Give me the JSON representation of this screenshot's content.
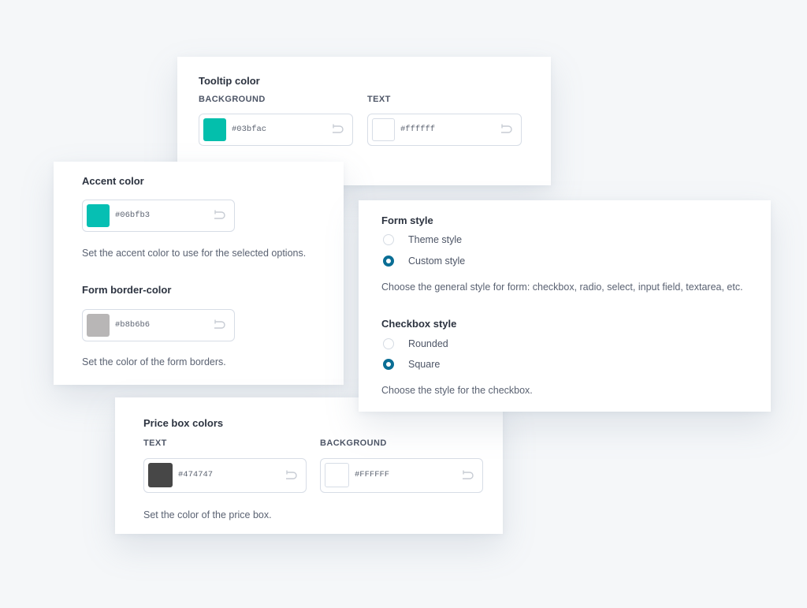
{
  "tooltip_color": {
    "title": "Tooltip color",
    "fields": [
      {
        "label": "BACKGROUND",
        "hex": "#03bfac",
        "swatch": "#03bfac"
      },
      {
        "label": "TEXT",
        "hex": "#ffffff",
        "swatch": "#ffffff"
      }
    ]
  },
  "accent_color": {
    "title": "Accent color",
    "hex": "#06bfb3",
    "swatch": "#06bfb3",
    "description": "Set the accent color to use for the selected options."
  },
  "form_border_color": {
    "title": "Form border-color",
    "hex": "#b8b6b6",
    "swatch": "#b8b6b6",
    "description": "Set the color of the form borders."
  },
  "form_style": {
    "title": "Form style",
    "options": [
      {
        "label": "Theme style",
        "checked": false
      },
      {
        "label": "Custom style",
        "checked": true
      }
    ],
    "description": "Choose the general style for form: checkbox, radio, select, input field, textarea, etc."
  },
  "checkbox_style": {
    "title": "Checkbox style",
    "options": [
      {
        "label": "Rounded",
        "checked": false
      },
      {
        "label": "Square",
        "checked": true
      }
    ],
    "description": "Choose the style for the checkbox."
  },
  "price_box_colors": {
    "title": "Price box colors",
    "fields": [
      {
        "label": "TEXT",
        "hex": "#474747",
        "swatch": "#474747"
      },
      {
        "label": "BACKGROUND",
        "hex": "#FFFFFF",
        "swatch": "#ffffff"
      }
    ],
    "description": "Set the color of the price box."
  },
  "icons": {
    "reset": "undo-arrow-icon",
    "radio": "radio-button"
  },
  "colors": {
    "radio_checked": "#0a6e95",
    "field_border": "#d7dde6"
  }
}
